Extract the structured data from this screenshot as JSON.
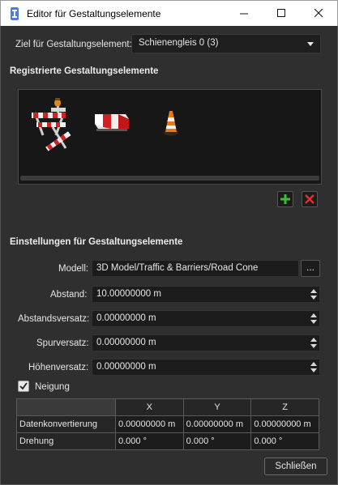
{
  "window": {
    "title": "Editor für Gestaltungselemente"
  },
  "target": {
    "label": "Ziel für Gestaltungselement:",
    "value": "Schienengleis 0 (3)"
  },
  "registered": {
    "title": "Registrierte Gestaltungselemente",
    "items": [
      "barrier-fence-icon",
      "traffic-barrier-icon",
      "traffic-cone-icon"
    ]
  },
  "settings": {
    "title": "Einstellungen für Gestaltungselemente",
    "model": {
      "label": "Modell:",
      "value": "3D Model/Traffic & Barriers/Road Cone",
      "browse_label": "..."
    },
    "spacing": {
      "label": "Abstand:",
      "value": "10.00000000 m"
    },
    "spacing_offset": {
      "label": "Abstandsversatz:",
      "value": "0.00000000 m"
    },
    "lane_offset": {
      "label": "Spurversatz:",
      "value": "0.00000000 m"
    },
    "height_offset": {
      "label": "Höhenversatz:",
      "value": "0.00000000 m"
    },
    "tilt": {
      "label": "Neigung",
      "checked": true
    },
    "table": {
      "columns": [
        "X",
        "Y",
        "Z"
      ],
      "rows": [
        {
          "label": "Datenkonvertierung",
          "values": [
            "0.00000000 m",
            "0.00000000 m",
            "0.00000000 m"
          ]
        },
        {
          "label": "Drehung",
          "values": [
            "0.000 °",
            "0.000 °",
            "0.000 °"
          ]
        }
      ]
    }
  },
  "footer": {
    "close_label": "Schließen"
  }
}
